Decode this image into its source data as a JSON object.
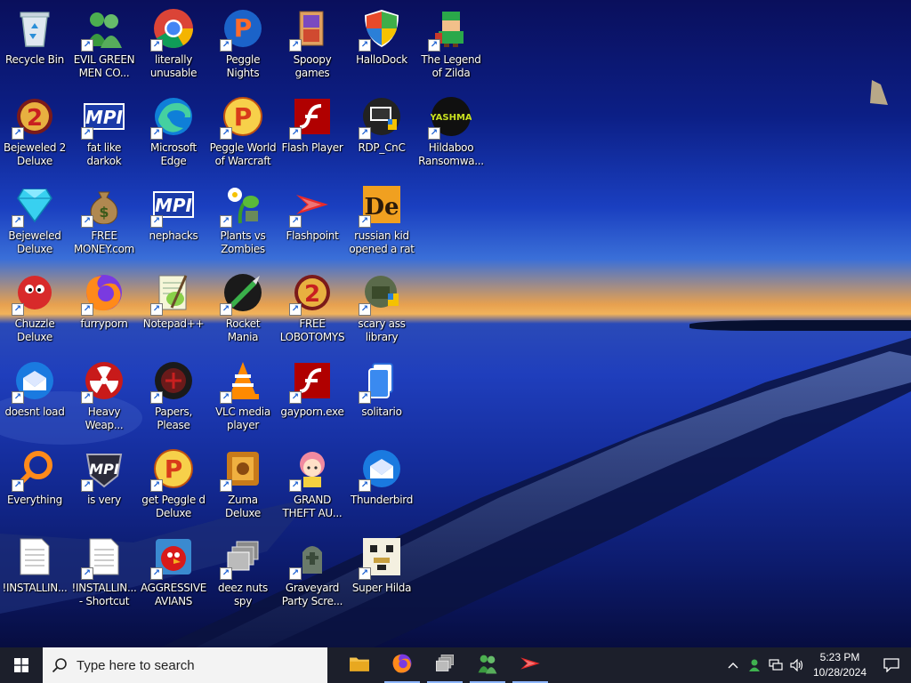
{
  "desktop": {
    "icons": [
      {
        "label": "Recycle Bin",
        "icon": "recycle-bin-icon",
        "shortcut": false
      },
      {
        "label": "EVIL GREEN MEN CO...",
        "icon": "messenger-men-icon",
        "shortcut": true
      },
      {
        "label": "literally unusable",
        "icon": "chrome-icon",
        "shortcut": true
      },
      {
        "label": "Peggle Nights Deluxe",
        "icon": "peggle-nights-icon",
        "shortcut": true
      },
      {
        "label": "Spoopy games",
        "icon": "folder-games-icon",
        "shortcut": true
      },
      {
        "label": "HalloDock",
        "icon": "windows-shield-icon",
        "shortcut": true
      },
      {
        "label": "The Legend of Zilda",
        "icon": "zelda-sprite-icon",
        "shortcut": true
      },
      {
        "label": "Bejeweled 2 Deluxe",
        "icon": "bejeweled2-icon",
        "shortcut": true
      },
      {
        "label": "fat like darkok",
        "icon": "mpi-icon",
        "shortcut": true
      },
      {
        "label": "Microsoft Edge",
        "icon": "edge-icon",
        "shortcut": true
      },
      {
        "label": "Peggle World of Warcraft ...",
        "icon": "peggle-icon",
        "shortcut": true
      },
      {
        "label": "Flash Player",
        "icon": "flash-player-icon",
        "shortcut": true
      },
      {
        "label": "RDP_CnC",
        "icon": "rdp-icon",
        "shortcut": true
      },
      {
        "label": "Hildaboo Ransomwa...",
        "icon": "yashma-icon",
        "shortcut": true
      },
      {
        "label": "Bejeweled Deluxe",
        "icon": "diamond-icon",
        "shortcut": true
      },
      {
        "label": "FREE MONEY.com",
        "icon": "money-bag-icon",
        "shortcut": true
      },
      {
        "label": "nephacks",
        "icon": "mpi-icon",
        "shortcut": true
      },
      {
        "label": "Plants vs Zombies",
        "icon": "plants-icon",
        "shortcut": true
      },
      {
        "label": "Flashpoint",
        "icon": "flashpoint-icon",
        "shortcut": true
      },
      {
        "label": "russian kid opened a rat",
        "icon": "de-icon",
        "shortcut": true
      },
      {
        "label": "Chuzzle Deluxe",
        "icon": "chuzzle-icon",
        "shortcut": true
      },
      {
        "label": "furryporn",
        "icon": "firefox-icon",
        "shortcut": true
      },
      {
        "label": "Notepad++",
        "icon": "notepadpp-icon",
        "shortcut": true
      },
      {
        "label": "Rocket Mania Deluxe",
        "icon": "rocket-icon",
        "shortcut": true
      },
      {
        "label": "FREE LOBOTOMYS",
        "icon": "bejeweled2-icon",
        "shortcut": true
      },
      {
        "label": "scary ass library",
        "icon": "library-icon",
        "shortcut": true
      },
      {
        "label": "doesnt load",
        "icon": "thunderbird-icon",
        "shortcut": true
      },
      {
        "label": "Heavy Weap...",
        "icon": "radiation-icon",
        "shortcut": true
      },
      {
        "label": "Papers, Please",
        "icon": "papers-please-icon",
        "shortcut": true
      },
      {
        "label": "VLC media player",
        "icon": "vlc-icon",
        "shortcut": true
      },
      {
        "label": "gayporn.exe",
        "icon": "flash-player-icon",
        "shortcut": true
      },
      {
        "label": "solitario",
        "icon": "solitaire-icon",
        "shortcut": true
      },
      {
        "label": "Everything",
        "icon": "magnifier-icon",
        "shortcut": true
      },
      {
        "label": "is very",
        "icon": "mpi-shield-icon",
        "shortcut": true
      },
      {
        "label": "get Peggle d Deluxe",
        "icon": "peggle-icon",
        "shortcut": true
      },
      {
        "label": "Zuma Deluxe",
        "icon": "zuma-icon",
        "shortcut": true
      },
      {
        "label": "GRAND THEFT AU...",
        "icon": "anime-girl-icon",
        "shortcut": true
      },
      {
        "label": "Thunderbird",
        "icon": "thunderbird-icon",
        "shortcut": true
      },
      {
        "label": "!INSTALLIN...",
        "icon": "text-document-icon",
        "shortcut": false
      },
      {
        "label": "!INSTALLIN... - Shortcut",
        "icon": "text-document-icon",
        "shortcut": true
      },
      {
        "label": "AGGRESSIVE AVIANS",
        "icon": "angry-bird-icon",
        "shortcut": true
      },
      {
        "label": "deez nuts spy",
        "icon": "windows-stack-icon",
        "shortcut": true
      },
      {
        "label": "Graveyard Party Scre...",
        "icon": "graveyard-icon",
        "shortcut": true
      },
      {
        "label": "Super Hilda",
        "icon": "pixel-dog-icon",
        "shortcut": true
      }
    ]
  },
  "taskbar": {
    "start_icon": "windows-logo-icon",
    "search_placeholder": "Type here to search",
    "pinned": [
      {
        "name": "file-explorer",
        "icon": "folder-icon",
        "active": false
      },
      {
        "name": "firefox",
        "icon": "firefox-icon",
        "active": true
      },
      {
        "name": "task-view",
        "icon": "windows-stack-icon",
        "active": true
      },
      {
        "name": "messenger",
        "icon": "messenger-men-icon",
        "active": true
      },
      {
        "name": "flashpoint",
        "icon": "flashpoint-icon",
        "active": true
      }
    ],
    "clock": {
      "time": "5:23 PM",
      "date": "10/28/2024"
    },
    "accent": "#8fb7ff",
    "background": "#1c1f2b"
  }
}
